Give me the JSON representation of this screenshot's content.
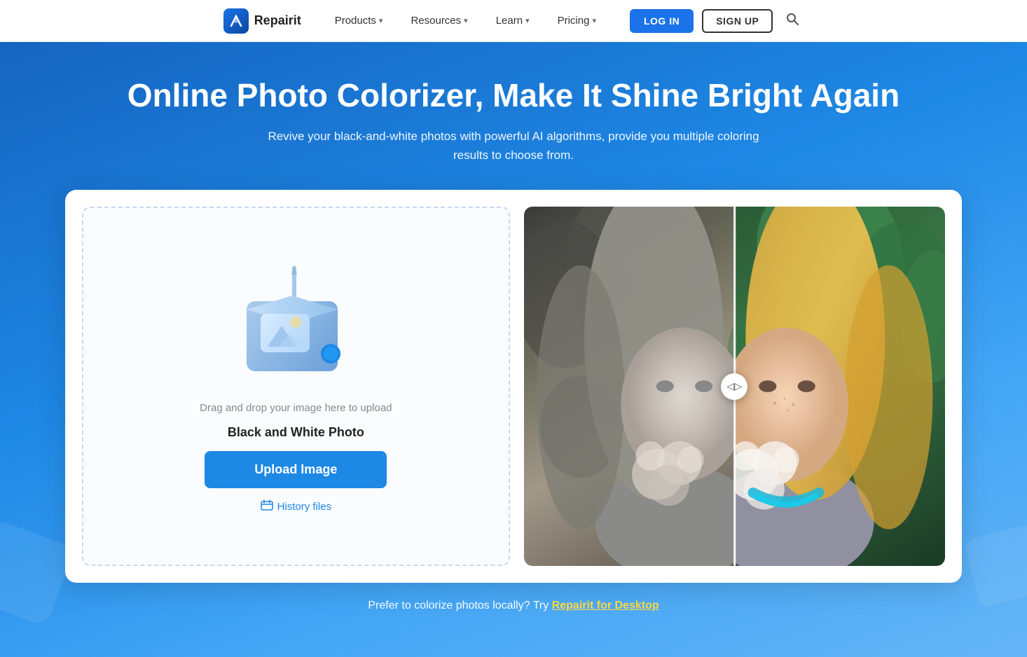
{
  "navbar": {
    "logo_text": "Repairit",
    "nav_items": [
      {
        "label": "Products",
        "id": "products"
      },
      {
        "label": "Resources",
        "id": "resources"
      },
      {
        "label": "Learn",
        "id": "learn"
      },
      {
        "label": "Pricing",
        "id": "pricing"
      }
    ],
    "login_label": "LOG IN",
    "signup_label": "SIGN UP"
  },
  "hero": {
    "title": "Online Photo Colorizer, Make It Shine Bright Again",
    "subtitle": "Revive your black-and-white photos with powerful AI algorithms, provide you multiple coloring results to choose from."
  },
  "upload_panel": {
    "drag_text": "Drag and drop your image here to upload",
    "file_type": "Black and White Photo",
    "upload_button": "Upload Image",
    "history_label": "History files"
  },
  "preview": {
    "slider_icon": "◁▷"
  },
  "footer_text": {
    "prefix": "Prefer to colorize photos locally? Try ",
    "link": "Repairit for Desktop"
  }
}
